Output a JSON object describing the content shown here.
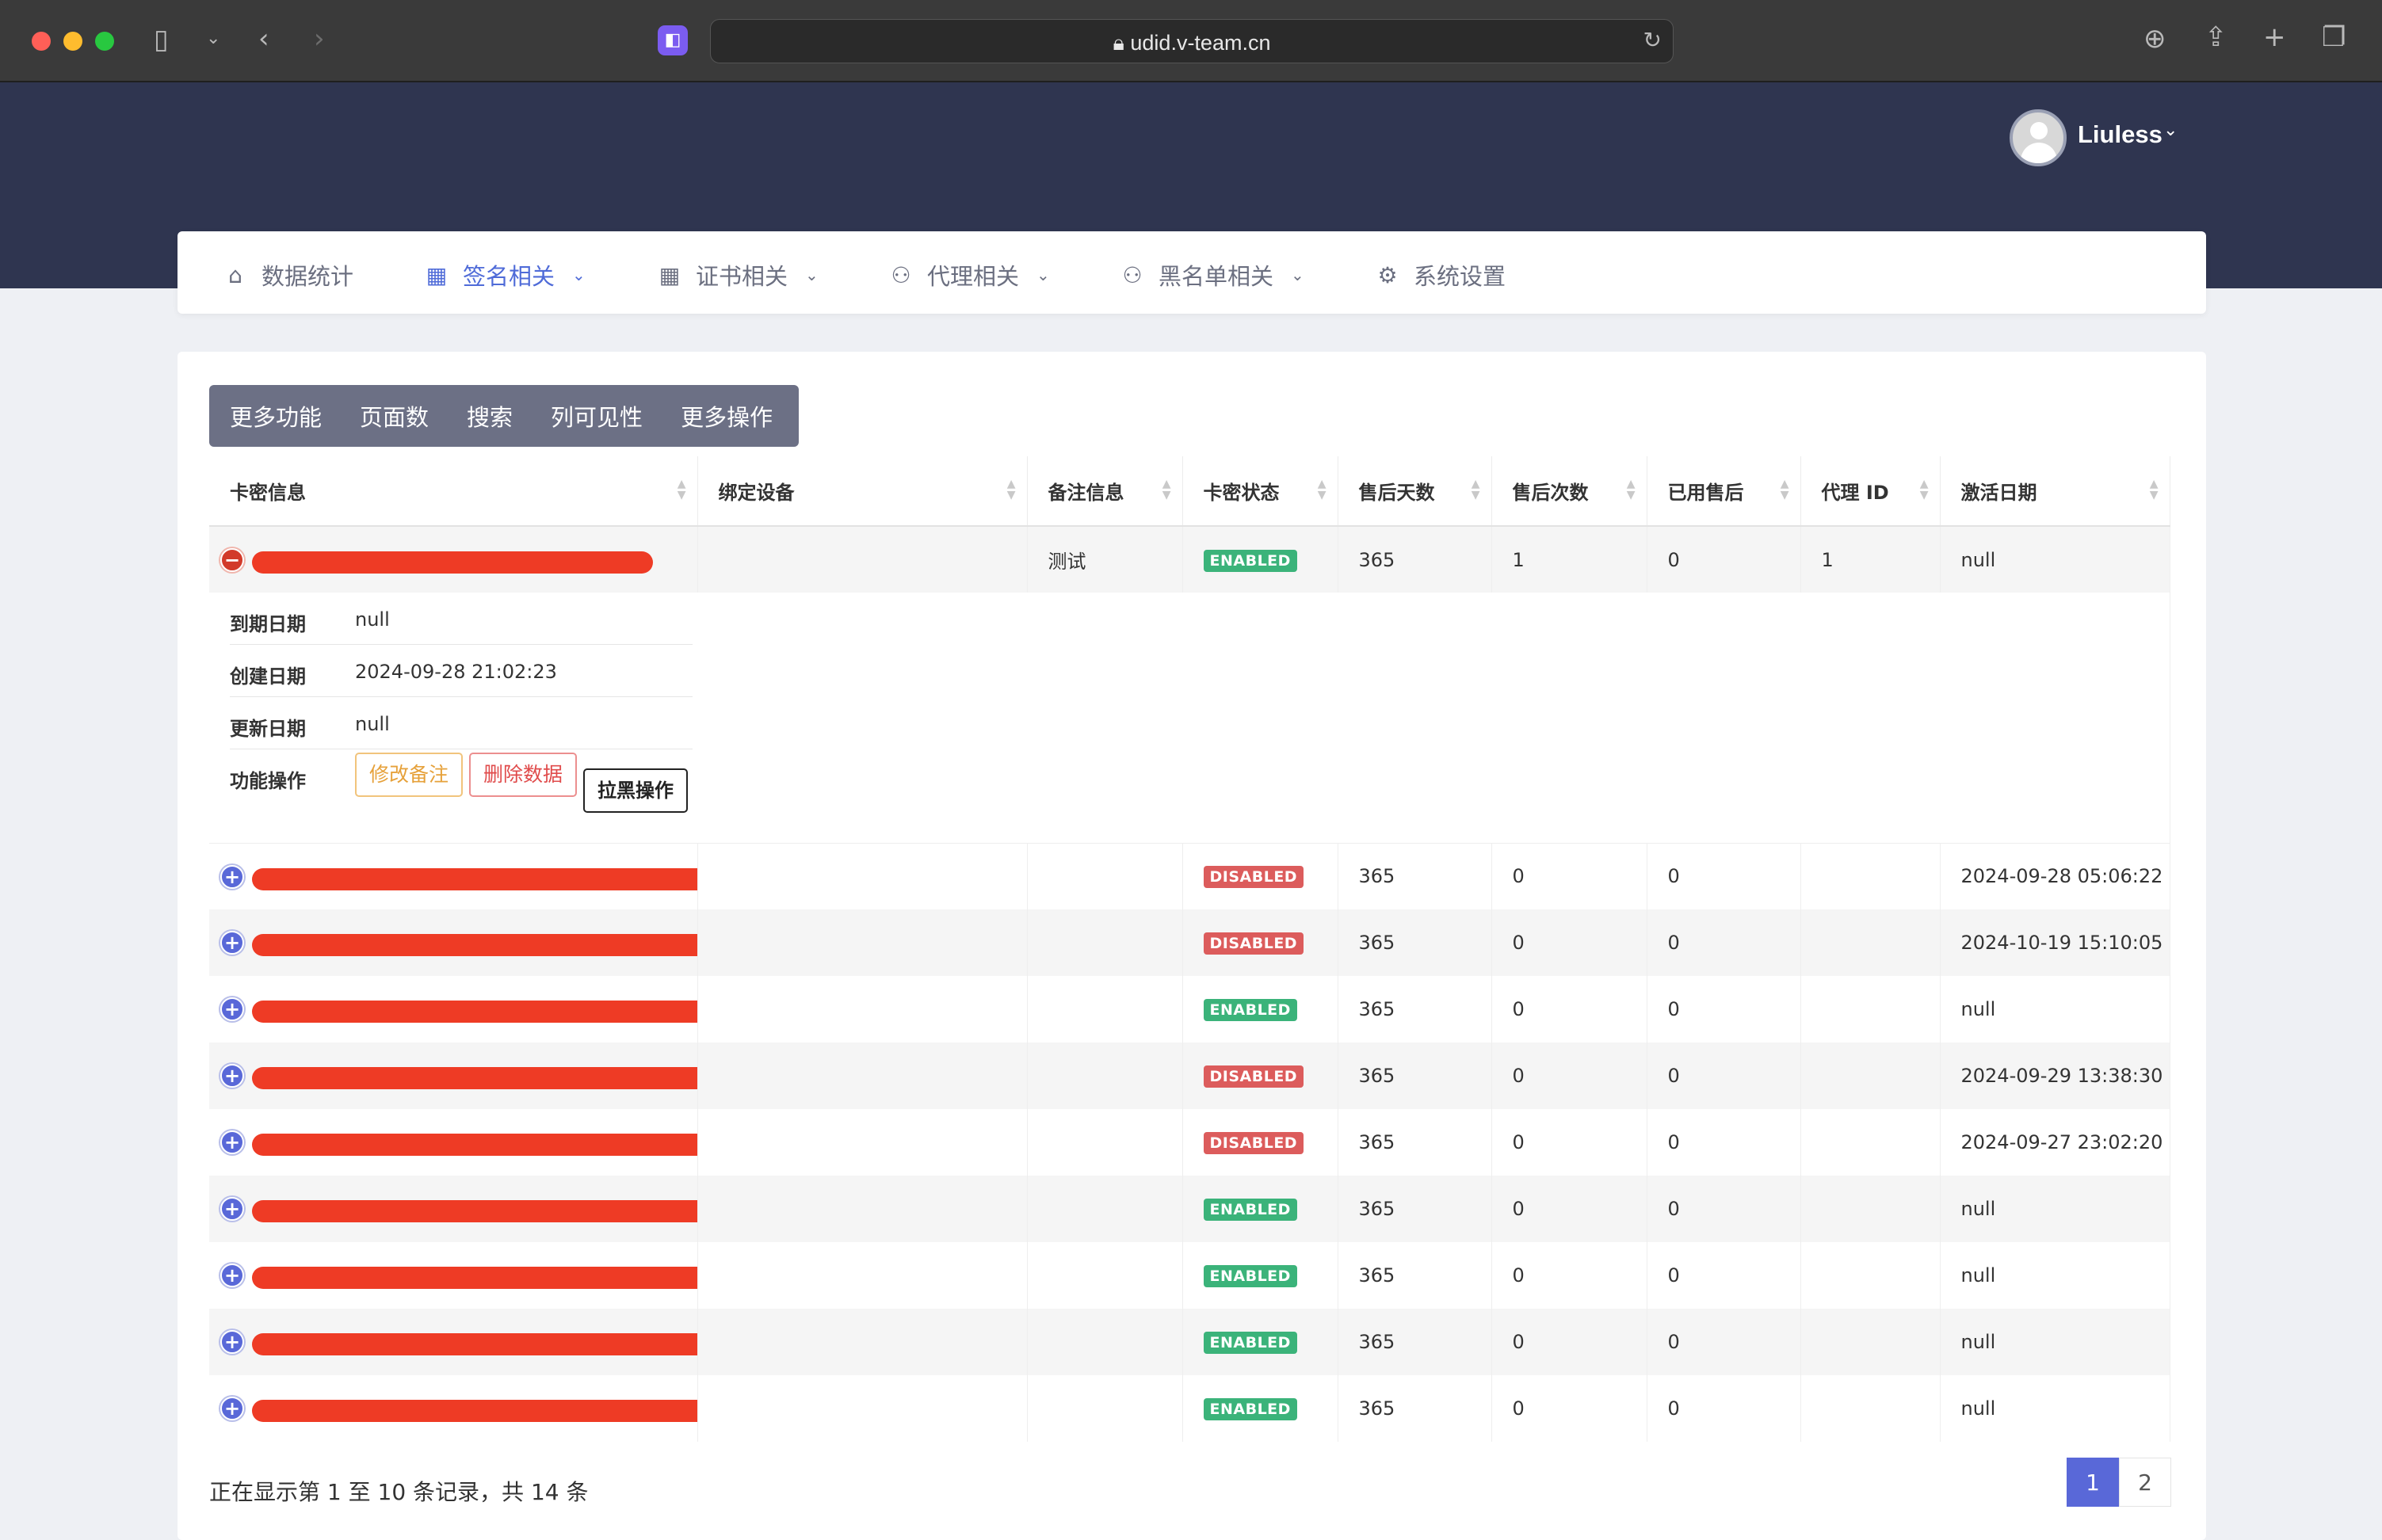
{
  "browser": {
    "url": "udid.v-team.cn"
  },
  "header": {
    "user_name": "Liuless"
  },
  "nav": {
    "items": [
      {
        "label": "数据统计",
        "icon": "home-icon",
        "active": false,
        "dropdown": false
      },
      {
        "label": "签名相关",
        "icon": "grid-icon",
        "active": true,
        "dropdown": true
      },
      {
        "label": "证书相关",
        "icon": "grid-icon",
        "active": false,
        "dropdown": true
      },
      {
        "label": "代理相关",
        "icon": "users-icon",
        "active": false,
        "dropdown": true
      },
      {
        "label": "黑名单相关",
        "icon": "users-icon",
        "active": false,
        "dropdown": true
      },
      {
        "label": "系统设置",
        "icon": "gear-icon",
        "active": false,
        "dropdown": false
      }
    ]
  },
  "toolbar": {
    "buttons": [
      "更多功能",
      "页面数",
      "搜索",
      "列可见性",
      "更多操作"
    ]
  },
  "table": {
    "columns": [
      "卡密信息",
      "绑定设备",
      "备注信息",
      "卡密状态",
      "售后天数",
      "售后次数",
      "已用售后",
      "代理 ID",
      "激活日期"
    ],
    "rows": [
      {
        "remark": "测试",
        "status": "ENABLED",
        "days": "365",
        "count": "1",
        "used": "0",
        "agent": "1",
        "activated": "null",
        "expanded": true
      },
      {
        "remark": "",
        "status": "DISABLED",
        "days": "365",
        "count": "0",
        "used": "0",
        "agent": "",
        "activated": "2024-09-28 05:06:22"
      },
      {
        "remark": "",
        "status": "DISABLED",
        "days": "365",
        "count": "0",
        "used": "0",
        "agent": "",
        "activated": "2024-10-19 15:10:05"
      },
      {
        "remark": "",
        "status": "ENABLED",
        "days": "365",
        "count": "0",
        "used": "0",
        "agent": "",
        "activated": "null"
      },
      {
        "remark": "",
        "status": "DISABLED",
        "days": "365",
        "count": "0",
        "used": "0",
        "agent": "",
        "activated": "2024-09-29 13:38:30"
      },
      {
        "remark": "",
        "status": "DISABLED",
        "days": "365",
        "count": "0",
        "used": "0",
        "agent": "",
        "activated": "2024-09-27 23:02:20"
      },
      {
        "remark": "",
        "status": "ENABLED",
        "days": "365",
        "count": "0",
        "used": "0",
        "agent": "",
        "activated": "null"
      },
      {
        "remark": "",
        "status": "ENABLED",
        "days": "365",
        "count": "0",
        "used": "0",
        "agent": "",
        "activated": "null"
      },
      {
        "remark": "",
        "status": "ENABLED",
        "days": "365",
        "count": "0",
        "used": "0",
        "agent": "",
        "activated": "null"
      },
      {
        "remark": "",
        "status": "ENABLED",
        "days": "365",
        "count": "0",
        "used": "0",
        "agent": "",
        "activated": "null"
      }
    ]
  },
  "detail": {
    "expire_label": "到期日期",
    "expire_value": "null",
    "created_label": "创建日期",
    "created_value": "2024-09-28 21:02:23",
    "updated_label": "更新日期",
    "updated_value": "null",
    "actions_label": "功能操作",
    "edit_note": "修改备注",
    "delete_data": "删除数据",
    "blacklist": "拉黑操作"
  },
  "footer": {
    "info": "正在显示第 1 至 10 条记录，共 14 条",
    "pages": [
      "1",
      "2"
    ],
    "current_page": "1"
  },
  "colors": {
    "header_bg": "#2f3550",
    "accent": "#5968d8",
    "enabled": "#3bb37a",
    "disabled": "#dc5c5c",
    "redaction": "#ee3b25"
  }
}
